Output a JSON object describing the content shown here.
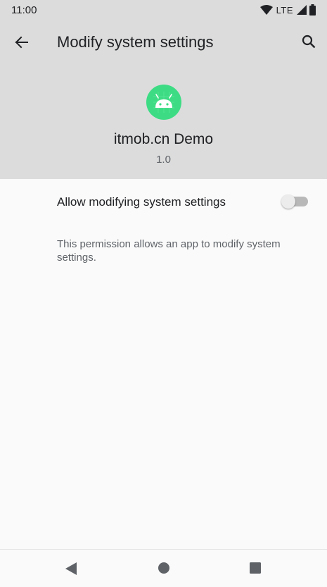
{
  "status": {
    "time": "11:00",
    "network": "LTE",
    "icons": [
      "wifi-icon",
      "signal-icon",
      "battery-icon"
    ]
  },
  "appbar": {
    "title": "Modify system settings",
    "back_icon": "arrow-back-icon",
    "search_icon": "search-icon"
  },
  "app": {
    "name": "itmob.cn Demo",
    "version": "1.0",
    "icon": "android-app-icon",
    "icon_color": "#3ddc84"
  },
  "setting": {
    "label": "Allow modifying system settings",
    "enabled": false,
    "description": "This permission allows an app to modify system settings."
  },
  "navigation": {
    "icons": [
      "nav-back-icon",
      "nav-home-icon",
      "nav-recents-icon"
    ]
  },
  "colors": {
    "header_bg": "#dcdcdc",
    "page_bg": "#fafafa",
    "text_primary": "#202124",
    "text_secondary": "#5f6368"
  }
}
